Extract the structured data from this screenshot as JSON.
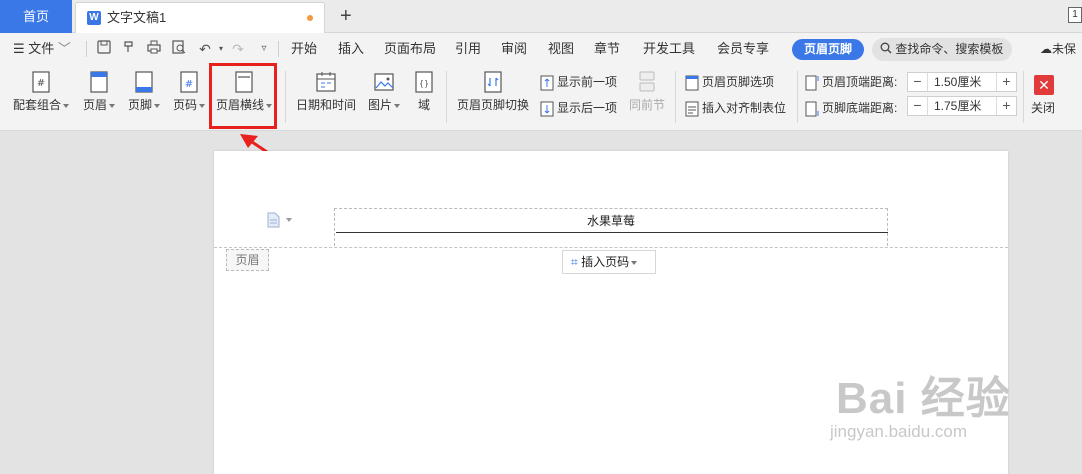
{
  "tabs": {
    "home": "首页",
    "doc_icon": "W",
    "doc_name": "文字文稿1",
    "add": "+",
    "right_badge": "1"
  },
  "menu": {
    "file": "文件",
    "items": [
      "开始",
      "插入",
      "页面布局",
      "引用",
      "审阅",
      "视图",
      "章节",
      "开发工具",
      "会员专享"
    ],
    "active": "页眉页脚",
    "search": "查找命令、搜索模板",
    "cloud": "未保"
  },
  "ribbon": {
    "combo": "配套组合",
    "header": "页眉",
    "footer": "页脚",
    "pagenum": "页码",
    "header_line": "页眉横线",
    "datetime": "日期和时间",
    "picture": "图片",
    "field": "域",
    "switch": "页眉页脚切换",
    "show_prev": "显示前一项",
    "show_next": "显示后一项",
    "same_prev": "同前节",
    "hf_options": "页眉页脚选项",
    "insert_tab": "插入对齐制表位",
    "top_dist_label": "页眉顶端距离:",
    "top_dist_value": "1.50厘米",
    "bottom_dist_label": "页脚底端距离:",
    "bottom_dist_value": "1.75厘米",
    "close": "关闭",
    "minus": "−",
    "plus": "+"
  },
  "document": {
    "header_text": "水果草莓",
    "header_tag": "页眉",
    "insert_pgnum": "插入页码"
  },
  "watermark": {
    "big": "Bai 经验",
    "small": "jingyan.baidu.com"
  },
  "colors": {
    "accent": "#3b78e7",
    "highlight": "#e8201e",
    "close": "#e03a3a"
  }
}
